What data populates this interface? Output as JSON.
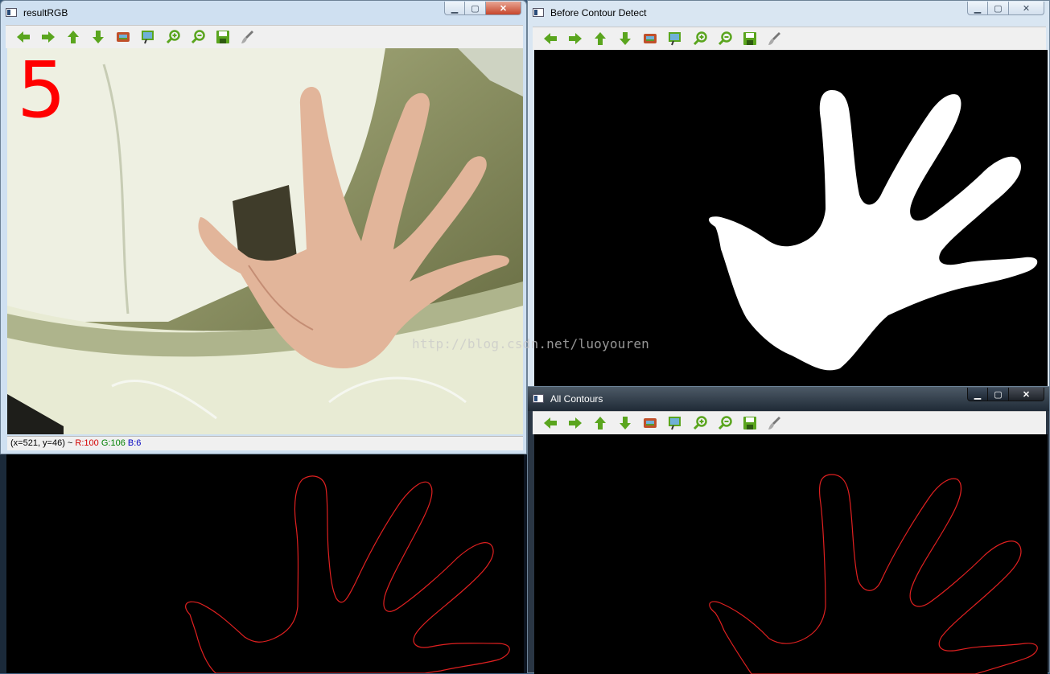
{
  "windows": {
    "result": {
      "title": "resultRGB",
      "count_label": "5",
      "status": {
        "coords": "(x=521, y=46) ~",
        "r": "R:100",
        "g": "G:106",
        "b": "B:6"
      }
    },
    "before": {
      "title": "Before Contour Detect"
    },
    "contours": {
      "title": "All Contours"
    }
  },
  "toolbar_icons": [
    "pan-left-icon",
    "pan-right-icon",
    "pan-up-icon",
    "pan-down-icon",
    "zoom-fit-icon",
    "zoom-original-icon",
    "zoom-in-icon",
    "zoom-out-icon",
    "save-icon",
    "properties-icon"
  ],
  "colors": {
    "contour": "#e02020",
    "count": "#ff0000",
    "status_r": "#d40000",
    "status_g": "#008000",
    "status_b": "#0000c0",
    "toolbar_green": "#5aa51e"
  },
  "watermark": "http://blog.csdn.net/luoyouren"
}
